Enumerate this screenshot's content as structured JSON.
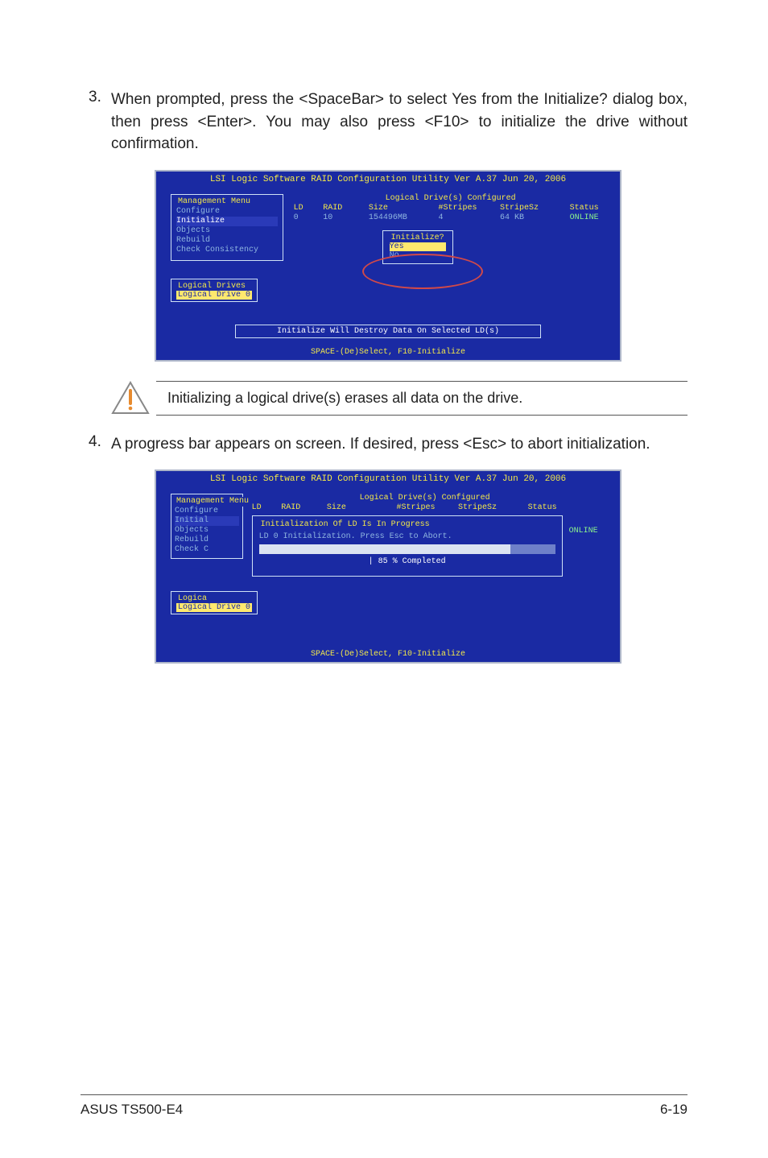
{
  "steps": {
    "s3": {
      "num": "3.",
      "text": "When prompted, press the <SpaceBar> to select Yes from the Initialize? dialog box, then press <Enter>. You may also press <F10> to initialize the drive without confirmation."
    },
    "s4": {
      "num": "4.",
      "text": "A progress bar appears on screen. If desired, press <Esc> to abort initialization."
    }
  },
  "bios1": {
    "title": "LSI Logic Software RAID Configuration Utility Ver A.37 Jun 20, 2006",
    "mgmt_legend": "Management Menu",
    "menu": {
      "m0": "Configure",
      "m1": "Initialize",
      "m2": "Objects",
      "m3": "Rebuild",
      "m4": "Check Consistency"
    },
    "table_legend": "Logical Drive(s) Configured",
    "head": {
      "ld": "LD",
      "raid": "RAID",
      "size": "Size",
      "stripes": "#Stripes",
      "ssz": "StripeSz",
      "status": "Status"
    },
    "row": {
      "ld": "0",
      "raid": "10",
      "size": "154496MB",
      "stripes": "4",
      "ssz": "64  KB",
      "status": "ONLINE"
    },
    "init_legend": "Initialize?",
    "opt_yes": "Yes",
    "opt_no": "No",
    "ld_legend": "Logical Drives",
    "ld_sel": "Logical Drive 0",
    "msg": "Initialize Will Destroy Data On Selected LD(s)",
    "hint": "SPACE-(De)Select,  F10-Initialize"
  },
  "note": "Initializing a logical drive(s) erases all data on the drive.",
  "bios2": {
    "title": "LSI Logic Software RAID Configuration Utility Ver A.37 Jun 20, 2006",
    "mgmt_legend": "Management Menu",
    "menu": {
      "m0": "Configure",
      "m1": "Initial",
      "m2": "Objects",
      "m3": "Rebuild",
      "m4": "Check C"
    },
    "table_legend": "Logical Drive(s) Configured",
    "head": {
      "ld": "LD",
      "raid": "RAID",
      "size": "Size",
      "stripes": "#Stripes",
      "ssz": "StripeSz",
      "status": "Status"
    },
    "prog_legend": "Initialization Of LD Is In Progress",
    "prog_line": "LD 0 Initialization. Press Esc to Abort.",
    "prog_pct": "|  85 % Completed",
    "status_side": "ONLINE",
    "ld_legend": "Logica",
    "ld_sel": "Logical Drive 0",
    "hint": "SPACE-(De)Select,  F10-Initialize"
  },
  "footer": {
    "left": "ASUS TS500-E4",
    "right": "6-19"
  }
}
